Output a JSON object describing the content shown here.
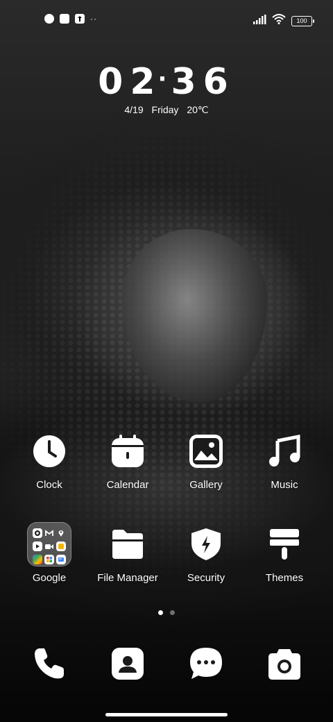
{
  "status_bar": {
    "left_icons": [
      "notification-icon",
      "square-icon",
      "upload-icon"
    ],
    "more": "··",
    "right_icons": [
      "signal-icon",
      "wifi-icon"
    ],
    "battery": "100"
  },
  "clock": {
    "hours": "02",
    "separator": "·",
    "minutes": "36"
  },
  "date": {
    "day_month": "4/19",
    "weekday": "Friday",
    "temperature": "20℃"
  },
  "apps_row1": [
    {
      "label": "Clock",
      "icon": "clock-icon"
    },
    {
      "label": "Calendar",
      "icon": "calendar-icon"
    },
    {
      "label": "Gallery",
      "icon": "gallery-icon"
    },
    {
      "label": "Music",
      "icon": "music-icon"
    }
  ],
  "apps_row2": [
    {
      "label": "Google",
      "icon": "google-folder-icon"
    },
    {
      "label": "File Manager",
      "icon": "folder-icon"
    },
    {
      "label": "Security",
      "icon": "shield-icon"
    },
    {
      "label": "Themes",
      "icon": "brush-icon"
    }
  ],
  "folder_contents": [
    "chrome",
    "gmail",
    "maps",
    "youtube",
    "meet",
    "drive",
    "photos",
    "google-one",
    "news"
  ],
  "dock": [
    {
      "icon": "phone-icon"
    },
    {
      "icon": "contacts-icon"
    },
    {
      "icon": "messages-icon"
    },
    {
      "icon": "camera-icon"
    }
  ],
  "pager": {
    "pages": 2,
    "active": 1
  }
}
